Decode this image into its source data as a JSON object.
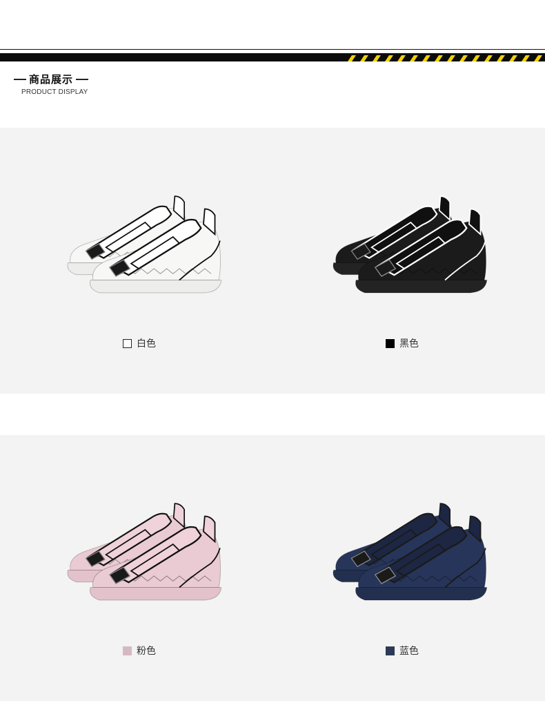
{
  "header": {
    "title_cn": "商品展示",
    "title_en": "PRODUCT DISPLAY"
  },
  "products": [
    {
      "label": "白色",
      "swatch": "#ffffff",
      "swatch_border": "#222222",
      "upper": "#f7f7f6",
      "sole": "#ededeb",
      "trim": "#111111",
      "tab": "#ffffff",
      "lace": "#ffffff"
    },
    {
      "label": "黑色",
      "swatch": "#000000",
      "swatch_border": "#000000",
      "upper": "#1b1b1b",
      "sole": "#232323",
      "trim": "#ffffff",
      "tab": "#101010",
      "lace": "#111111"
    },
    {
      "label": "粉色",
      "swatch": "#d6b9c0",
      "swatch_border": "#d6b9c0",
      "upper": "#eacbd3",
      "sole": "#e4c2cb",
      "trim": "#111111",
      "tab": "#efd2da",
      "lace": "#ecd0d8"
    },
    {
      "label": "蓝色",
      "swatch": "#2c3a55",
      "swatch_border": "#2c3a55",
      "upper": "#27355a",
      "sole": "#222f4f",
      "trim": "#1a1a1a",
      "tab": "#1d2743",
      "lace": "#1f2a47"
    }
  ]
}
